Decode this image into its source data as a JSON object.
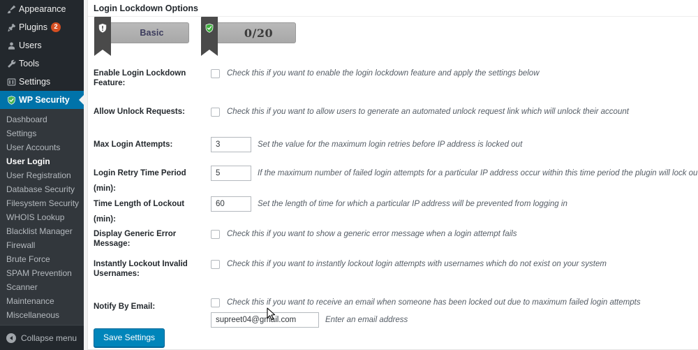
{
  "sidebar": {
    "top_items": [
      {
        "label": "Appearance",
        "icon": "appearance-brush-icon",
        "badge": null
      },
      {
        "label": "Plugins",
        "icon": "plugins-plug-icon",
        "badge": "2"
      },
      {
        "label": "Users",
        "icon": "users-person-icon",
        "badge": null
      },
      {
        "label": "Tools",
        "icon": "tools-wrench-icon",
        "badge": null
      },
      {
        "label": "Settings",
        "icon": "settings-sliders-icon",
        "badge": null
      }
    ],
    "active_item": {
      "label": "WP Security",
      "icon": "shield-check-icon"
    },
    "submenu": [
      {
        "label": "Dashboard",
        "current": false
      },
      {
        "label": "Settings",
        "current": false
      },
      {
        "label": "User Accounts",
        "current": false
      },
      {
        "label": "User Login",
        "current": true
      },
      {
        "label": "User Registration",
        "current": false
      },
      {
        "label": "Database Security",
        "current": false
      },
      {
        "label": "Filesystem Security",
        "current": false
      },
      {
        "label": "WHOIS Lookup",
        "current": false
      },
      {
        "label": "Blacklist Manager",
        "current": false
      },
      {
        "label": "Firewall",
        "current": false
      },
      {
        "label": "Brute Force",
        "current": false
      },
      {
        "label": "SPAM Prevention",
        "current": false
      },
      {
        "label": "Scanner",
        "current": false
      },
      {
        "label": "Maintenance",
        "current": false
      },
      {
        "label": "Miscellaneous",
        "current": false
      }
    ],
    "collapse_label": "Collapse menu",
    "colors": {
      "background": "#23282d",
      "submenu_background": "#32373c",
      "active_background": "#0073aa",
      "badge_background": "#d54e21"
    }
  },
  "panel": {
    "title": "Login Lockdown Options",
    "badges": [
      {
        "text": "Basic",
        "icon": "shield-gray-icon",
        "name": "basic-level-badge"
      },
      {
        "text": "0/20",
        "icon": "shield-green-check-icon",
        "name": "security-score-badge"
      }
    ],
    "rows": [
      {
        "label": "Enable Login Lockdown Feature:",
        "type": "checkbox",
        "checked": false,
        "desc": "Check this if you want to enable the login lockdown feature and apply the settings below"
      },
      {
        "label": "Allow Unlock Requests:",
        "type": "checkbox",
        "checked": false,
        "desc": "Check this if you want to allow users to generate an automated unlock request link which will unlock their account"
      },
      {
        "label": "Max Login Attempts:",
        "type": "number",
        "value": "3",
        "desc": "Set the value for the maximum login retries before IP address is locked out"
      },
      {
        "label": "Login Retry Time Period (min):",
        "type": "number",
        "value": "5",
        "desc": "If the maximum number of failed login attempts for a particular IP address occur within this time period the plugin will lock out that address"
      },
      {
        "label": "Time Length of Lockout (min):",
        "type": "number",
        "value": "60",
        "desc": "Set the length of time for which a particular IP address will be prevented from logging in"
      },
      {
        "label": "Display Generic Error Message:",
        "type": "checkbox",
        "checked": false,
        "desc": "Check this if you want to show a generic error message when a login attempt fails"
      },
      {
        "label": "Instantly Lockout Invalid Usernames:",
        "type": "checkbox",
        "checked": false,
        "desc": "Check this if you want to instantly lockout login attempts with usernames which do not exist on your system"
      }
    ],
    "notify_row": {
      "label": "Notify By Email:",
      "checked": false,
      "desc": "Check this if you want to receive an email when someone has been locked out due to maximum failed login attempts",
      "email_value": "supreet04@gmail.com",
      "email_desc": "Enter an email address"
    },
    "save_label": "Save Settings",
    "accent_color": "#0085ba"
  }
}
